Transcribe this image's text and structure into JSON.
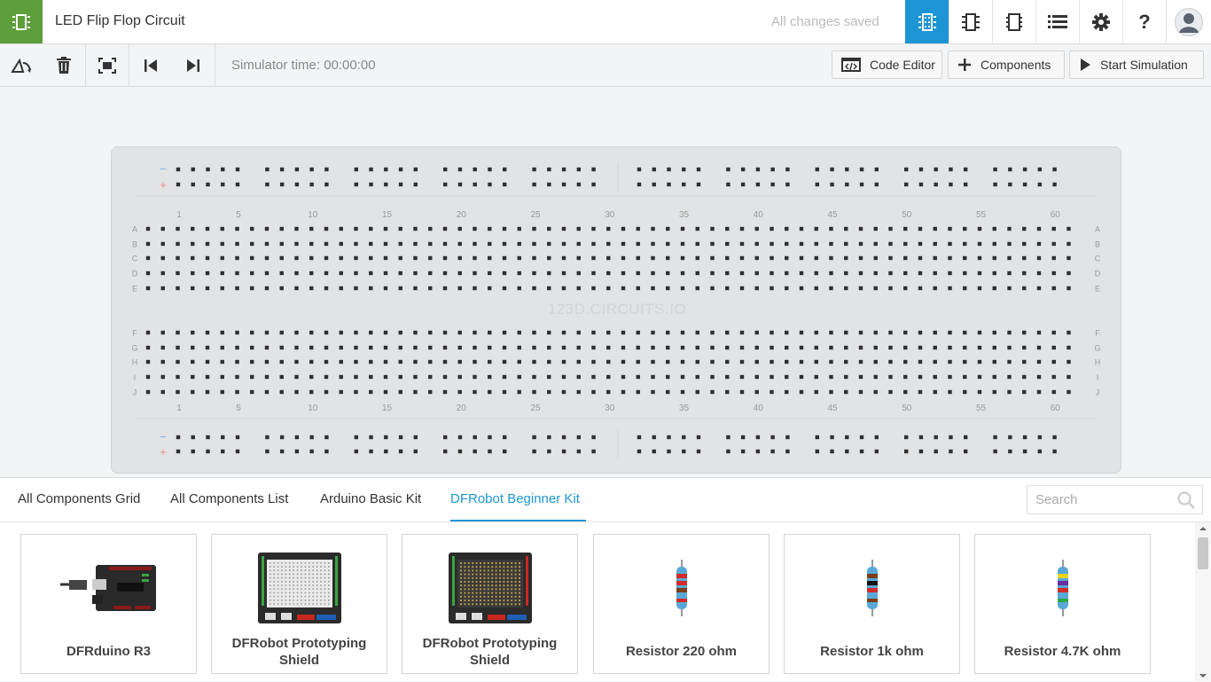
{
  "header": {
    "title": "LED Flip Flop Circuit",
    "status": "All changes saved"
  },
  "toolbar": {
    "simulator_time": "Simulator time: 00:00:00",
    "code_editor": "Code Editor",
    "components": "Components",
    "start_simulation": "Start Simulation"
  },
  "breadboard": {
    "watermark": "123D.CIRCUITS.IO",
    "column_numbers": [
      "1",
      "5",
      "10",
      "15",
      "20",
      "25",
      "30",
      "35",
      "40",
      "45",
      "50",
      "55",
      "60"
    ],
    "rows_top": [
      "A",
      "B",
      "C",
      "D",
      "E"
    ],
    "rows_bottom": [
      "F",
      "G",
      "H",
      "I",
      "J"
    ],
    "rail_minus": "−",
    "rail_plus": "+"
  },
  "panel": {
    "tabs": [
      {
        "label": "All Components Grid"
      },
      {
        "label": "All Components List"
      },
      {
        "label": "Arduino Basic Kit"
      },
      {
        "label": "DFRobot Beginner Kit"
      }
    ],
    "search_placeholder": "Search",
    "components": [
      {
        "name": "DFRduino R3"
      },
      {
        "name": "DFRobot Prototyping Shield"
      },
      {
        "name": "DFRobot Prototyping Shield"
      },
      {
        "name": "Resistor 220 ohm"
      },
      {
        "name": "Resistor 1k ohm"
      },
      {
        "name": "Resistor 4.7K ohm"
      }
    ]
  },
  "colors": {
    "brand_green": "#5e9e3b",
    "accent_blue": "#1d95d4"
  }
}
